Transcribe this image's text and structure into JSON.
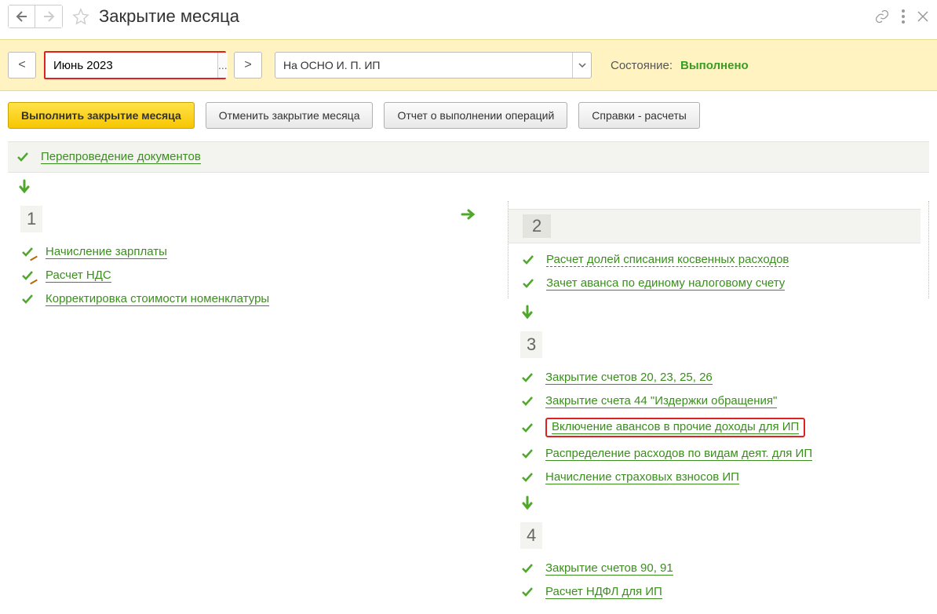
{
  "header": {
    "title": "Закрытие месяца"
  },
  "filter": {
    "period": "Июнь 2023",
    "organization": "На ОСНО И. П. ИП",
    "status_label": "Состояние:",
    "status_value": "Выполнено"
  },
  "actions": {
    "execute": "Выполнить закрытие месяца",
    "cancel": "Отменить закрытие месяца",
    "report": "Отчет о выполнении операций",
    "references": "Справки - расчеты"
  },
  "reprocess": {
    "label": "Перепроведение документов"
  },
  "stages": {
    "s1": {
      "number": "1",
      "ops": [
        {
          "label": "Начисление зарплаты"
        },
        {
          "label": "Расчет НДС"
        },
        {
          "label": "Корректировка стоимости номенклатуры"
        }
      ]
    },
    "s2": {
      "number": "2",
      "ops": [
        {
          "label": "Расчет долей списания косвенных расходов"
        },
        {
          "label": "Зачет аванса по единому налоговому счету"
        }
      ]
    },
    "s3": {
      "number": "3",
      "ops": [
        {
          "label": "Закрытие счетов 20, 23, 25, 26"
        },
        {
          "label": "Закрытие счета 44 \"Издержки обращения\""
        },
        {
          "label": "Включение авансов в прочие доходы для ИП"
        },
        {
          "label": "Распределение расходов по видам деят. для ИП"
        },
        {
          "label": "Начисление страховых взносов ИП"
        }
      ]
    },
    "s4": {
      "number": "4",
      "ops": [
        {
          "label": "Закрытие счетов 90, 91"
        },
        {
          "label": "Расчет НДФЛ для ИП"
        }
      ]
    }
  }
}
